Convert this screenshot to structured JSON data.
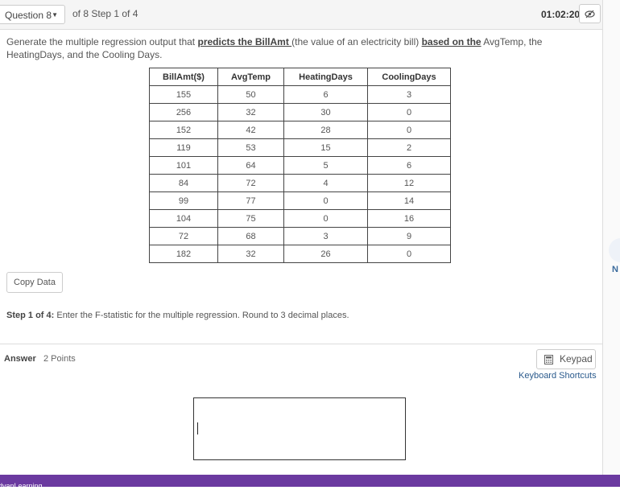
{
  "header": {
    "question_label": "Question 8",
    "step_text": "of 8 Step 1 of 4",
    "timer": "01:02:20"
  },
  "question": {
    "part1": "Generate the multiple regression output that ",
    "bold1": "predicts the BillAmt ",
    "part2": "(the value of an electricity bill) ",
    "bold2": "based on the",
    "part3": " AvgTemp, the HeatingDays, and the Cooling Days."
  },
  "table": {
    "headers": [
      "BillAmt($)",
      "AvgTemp",
      "HeatingDays",
      "CoolingDays"
    ],
    "rows": [
      [
        "155",
        "50",
        "6",
        "3"
      ],
      [
        "256",
        "32",
        "30",
        "0"
      ],
      [
        "152",
        "42",
        "28",
        "0"
      ],
      [
        "119",
        "53",
        "15",
        "2"
      ],
      [
        "101",
        "64",
        "5",
        "6"
      ],
      [
        "84",
        "72",
        "4",
        "12"
      ],
      [
        "99",
        "77",
        "0",
        "14"
      ],
      [
        "104",
        "75",
        "0",
        "16"
      ],
      [
        "72",
        "68",
        "3",
        "9"
      ],
      [
        "182",
        "32",
        "26",
        "0"
      ]
    ]
  },
  "copy_data_label": "Copy Data",
  "step": {
    "bold": "Step 1 of 4:",
    "text": " Enter the F-statistic for the multiple regression. Round to 3 decimal places."
  },
  "answer": {
    "label": "Answer",
    "points": "2 Points",
    "keypad_label": "Keypad",
    "shortcuts_label": "Keyboard Shortcuts"
  },
  "side_badge": "N",
  "footer_text": "dvanLearning",
  "colors": {
    "footer": "#6b3aa0",
    "link": "#2a5a8c"
  }
}
